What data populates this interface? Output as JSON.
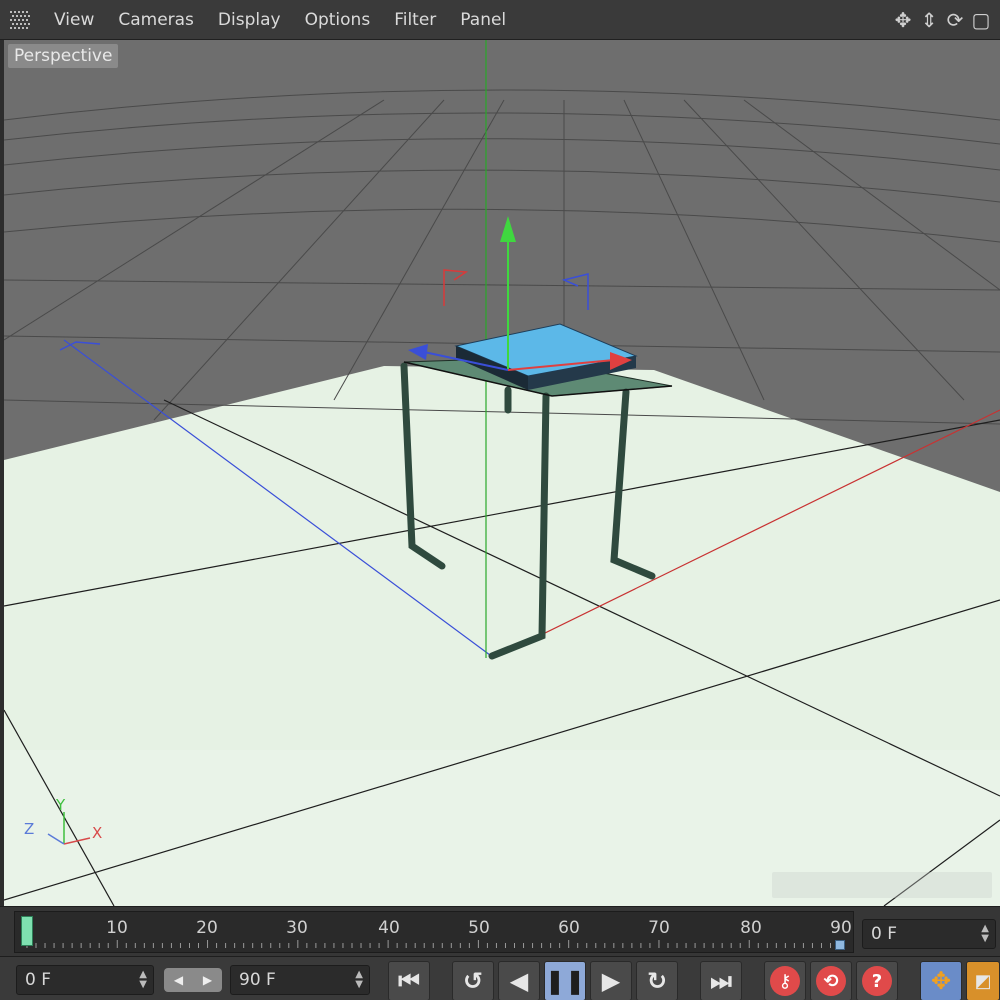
{
  "menu": {
    "items": [
      "View",
      "Cameras",
      "Display",
      "Options",
      "Filter",
      "Panel"
    ]
  },
  "viewport": {
    "camera_label": "Perspective",
    "axis_labels": {
      "x": "X",
      "y": "Y",
      "z": "Z"
    }
  },
  "timeline": {
    "tick_labels": [
      "10",
      "20",
      "30",
      "40",
      "50",
      "60",
      "70",
      "80",
      "90"
    ],
    "current_frame": "0 F"
  },
  "controls": {
    "start_frame": "0 F",
    "end_frame": "90 F"
  },
  "colors": {
    "floor": "#e6f2e4",
    "x_axis": "#d84a4a",
    "y_axis": "#3fbf3f",
    "z_axis": "#3a4fd8",
    "table": "#2f4a3e",
    "cushion": "#5cb8e8",
    "playhead": "#7fe0b0",
    "active_button": "#8ea9d8"
  }
}
